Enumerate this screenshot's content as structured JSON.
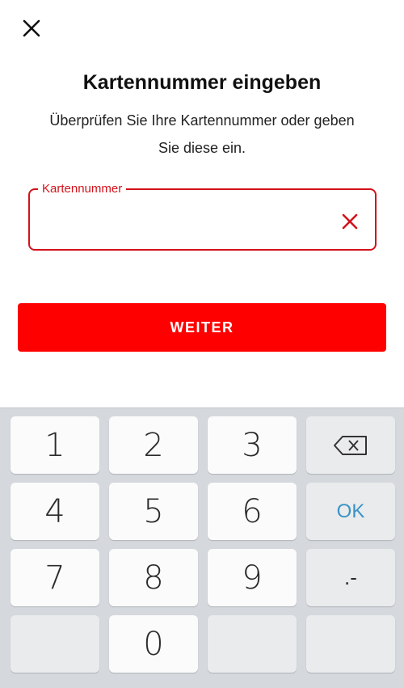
{
  "header": {
    "close_icon": "close-icon"
  },
  "title": "Kartennummer eingeben",
  "subtitle": "Überprüfen Sie Ihre Kartennummer oder geben Sie diese ein.",
  "field": {
    "label": "Kartennummer",
    "value": "",
    "placeholder": "",
    "clear_icon": "clear-icon"
  },
  "primary_button": {
    "label": "WEITER"
  },
  "keyboard": {
    "keys": {
      "k1": "1",
      "k2": "2",
      "k3": "3",
      "k4": "4",
      "k5": "5",
      "k6": "6",
      "k7": "7",
      "k8": "8",
      "k9": "9",
      "k0": "0",
      "ok": "OK",
      "sym": ".-"
    },
    "backspace_icon": "backspace-icon"
  },
  "colors": {
    "accent": "#ff0000",
    "field_border": "#d3121a",
    "ok_text": "#3a93c6",
    "keyboard_bg": "#d5d8dd"
  }
}
